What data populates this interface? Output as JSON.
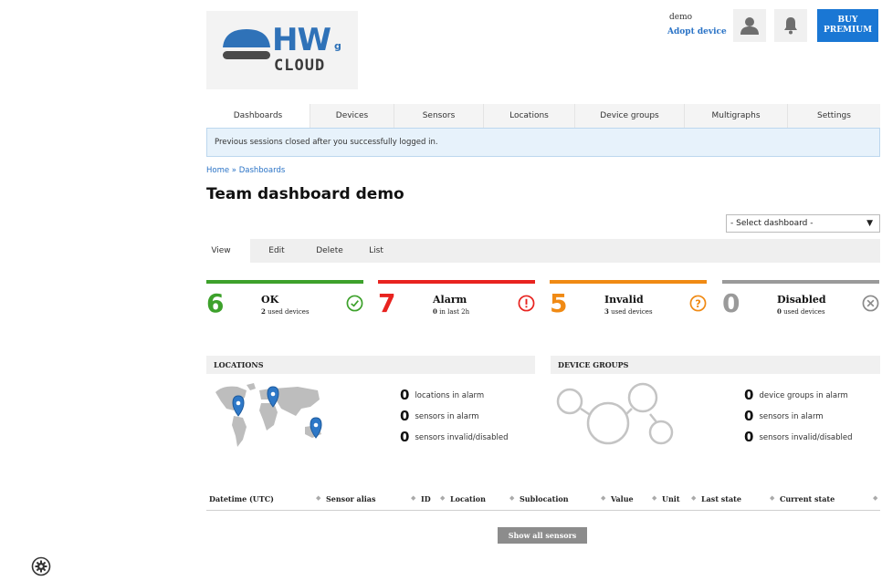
{
  "header": {
    "logo": {
      "hw": "HW",
      "g": "g",
      "cloud": "CLOUD"
    },
    "user": "demo",
    "adopt_device": "Adopt device",
    "buy_line1": "BUY",
    "buy_line2": "PREMIUM",
    "icons": [
      "user-icon",
      "bell-icon"
    ]
  },
  "nav": {
    "items": [
      "Dashboards",
      "Devices",
      "Sensors",
      "Locations",
      "Device groups",
      "Multigraphs",
      "Settings"
    ],
    "active": "Dashboards"
  },
  "alert": "Previous sessions closed after you successfully logged in.",
  "breadcrumb": {
    "home": "Home",
    "sep": " » ",
    "current": "Dashboards"
  },
  "page_title": "Team dashboard demo",
  "dashboard_select": {
    "selected": "- Select dashboard -"
  },
  "subtabs": {
    "items": [
      "View",
      "Edit",
      "Delete",
      "List"
    ],
    "active": "View"
  },
  "status_cards": [
    {
      "number": "6",
      "label": "OK",
      "sub_value": "2",
      "sub_text": "used devices",
      "color": "#3da12b",
      "icon": "check-circle-icon"
    },
    {
      "number": "7",
      "label": "Alarm",
      "sub_value": "0",
      "sub_text": "in last 2h",
      "color": "#e8231f",
      "icon": "exclamation-circle-icon"
    },
    {
      "number": "5",
      "label": "Invalid",
      "sub_value": "3",
      "sub_text": "used devices",
      "color": "#f08a14",
      "icon": "question-circle-icon"
    },
    {
      "number": "0",
      "label": "Disabled",
      "sub_value": "0",
      "sub_text": "used devices",
      "color": "#9a9a9a",
      "icon": "x-circle-icon"
    }
  ],
  "locations": {
    "heading": "LOCATIONS",
    "stats": [
      {
        "value": "0",
        "label": "locations in alarm"
      },
      {
        "value": "0",
        "label": "sensors in alarm"
      },
      {
        "value": "0",
        "label": "sensors invalid/disabled"
      }
    ]
  },
  "device_groups": {
    "heading": "DEVICE GROUPS",
    "stats": [
      {
        "value": "0",
        "label": "device groups in alarm"
      },
      {
        "value": "0",
        "label": "sensors in alarm"
      },
      {
        "value": "0",
        "label": "sensors invalid/disabled"
      }
    ]
  },
  "table": {
    "columns": [
      "Datetime (UTC)",
      "Sensor alias",
      "ID",
      "Location",
      "Sublocation",
      "Value",
      "Unit",
      "Last state",
      "Current state"
    ]
  },
  "show_all_button": "Show all sensors",
  "colors": {
    "accent": "#1a77d4",
    "link": "#2a73c6",
    "ok": "#3da12b",
    "alarm": "#e8231f",
    "invalid": "#f08a14",
    "disabled": "#9a9a9a"
  }
}
